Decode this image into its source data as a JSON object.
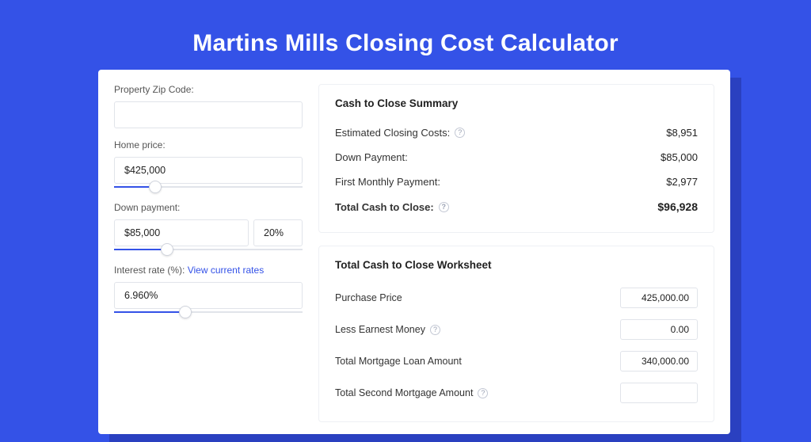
{
  "title": "Martins Mills Closing Cost Calculator",
  "form": {
    "zip": {
      "label": "Property Zip Code:",
      "value": ""
    },
    "price": {
      "label": "Home price:",
      "value": "$425,000",
      "slider_pct": 22
    },
    "down": {
      "label": "Down payment:",
      "value": "$85,000",
      "pct": "20%",
      "slider_pct": 28
    },
    "rate": {
      "label": "Interest rate (%): ",
      "rates_link": "View current rates",
      "value": "6.960%",
      "slider_pct": 38
    }
  },
  "summary": {
    "heading": "Cash to Close Summary",
    "rows": [
      {
        "label": "Estimated Closing Costs:",
        "help": true,
        "value": "$8,951"
      },
      {
        "label": "Down Payment:",
        "help": false,
        "value": "$85,000"
      },
      {
        "label": "First Monthly Payment:",
        "help": false,
        "value": "$2,977"
      }
    ],
    "total": {
      "label": "Total Cash to Close:",
      "help": true,
      "value": "$96,928"
    }
  },
  "worksheet": {
    "heading": "Total Cash to Close Worksheet",
    "rows": [
      {
        "label": "Purchase Price",
        "help": false,
        "value": "425,000.00"
      },
      {
        "label": "Less Earnest Money",
        "help": true,
        "value": "0.00"
      },
      {
        "label": "Total Mortgage Loan Amount",
        "help": false,
        "value": "340,000.00"
      },
      {
        "label": "Total Second Mortgage Amount",
        "help": true,
        "value": ""
      }
    ]
  }
}
